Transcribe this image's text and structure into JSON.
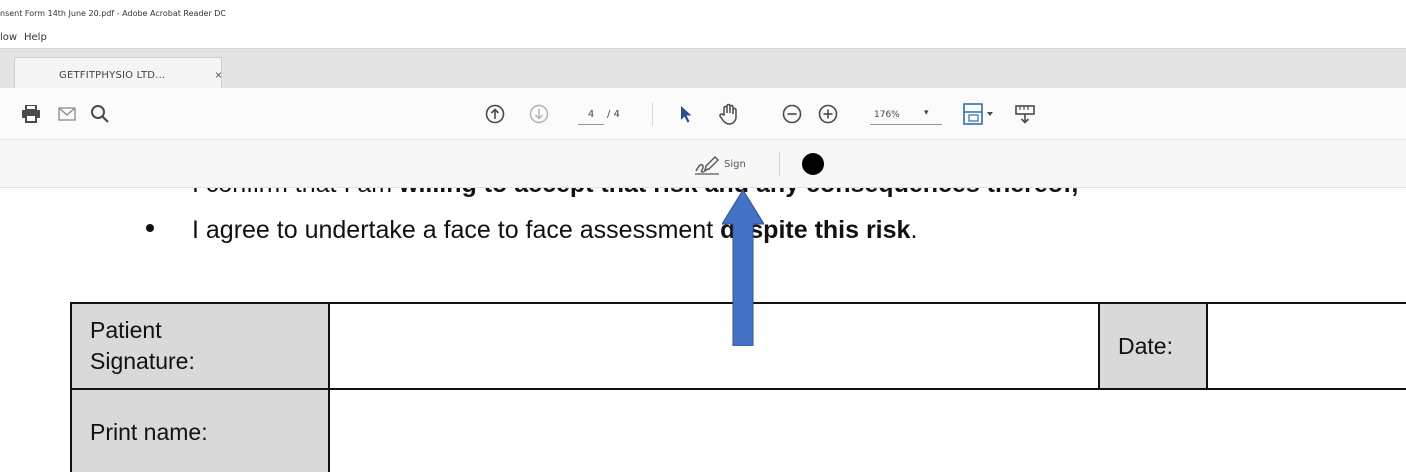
{
  "window": {
    "title": "nsent Form 14th June 20.pdf - Adobe Acrobat Reader DC"
  },
  "menu": {
    "items": [
      "low",
      "Help"
    ]
  },
  "tabs": [
    {
      "label": "GETFITPHYSIO LTD...",
      "close": "×"
    }
  ],
  "toolbar": {
    "page_current": "4",
    "page_total": "/ 4",
    "zoom": "176%",
    "zoom_chevron": "▾",
    "icons": [
      "print-icon",
      "email-icon",
      "search-icon",
      "page-up-icon",
      "page-down-icon",
      "select-arrow-icon",
      "hand-icon",
      "zoom-out-icon",
      "zoom-in-icon",
      "fit-page-icon",
      "more-tools-icon"
    ]
  },
  "signbar": {
    "sign_label": "Sign",
    "ink_color": "#000000"
  },
  "document": {
    "bullet_1": {
      "plain": "I confirm that I am ",
      "bold": "willing to accept that risk and any consequences thereof,"
    },
    "bullet_2": {
      "plain": "I agree to undertake a face to face assessment ",
      "bold": "despite this risk",
      "end": "."
    },
    "table": {
      "patient_signature_line1": "Patient",
      "patient_signature_line2": "Signature:",
      "date_label": "Date:",
      "print_name_label": "Print name:"
    }
  },
  "annotation": {
    "arrow_color": "#4472c4"
  }
}
